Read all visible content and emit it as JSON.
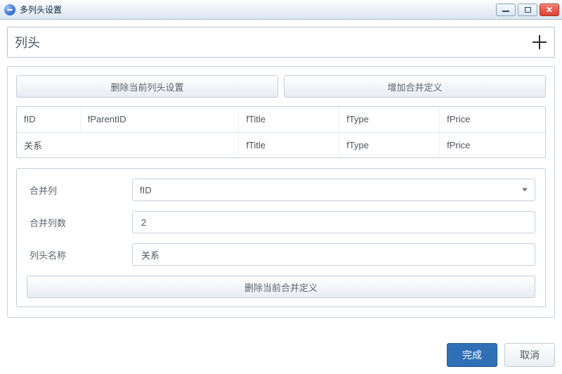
{
  "window": {
    "title": "多列头设置"
  },
  "section": {
    "title": "列头"
  },
  "toolbar": {
    "delete_current_header": "删除当前列头设置",
    "add_merge_def": "增加合并定义"
  },
  "grid": {
    "rows": [
      [
        "fID",
        "fParentID",
        "fTitle",
        "fType",
        "fPrice"
      ],
      [
        "关系",
        "",
        "fTitle",
        "fType",
        "fPrice"
      ]
    ]
  },
  "form": {
    "merge_col_label": "合并列",
    "merge_col_value": "fID",
    "merge_count_label": "合并列数",
    "merge_count_value": "2",
    "header_name_label": "列头名称",
    "header_name_value": "关系",
    "delete_current_merge": "删除当前合并定义"
  },
  "footer": {
    "ok": "完成",
    "cancel": "取消"
  }
}
